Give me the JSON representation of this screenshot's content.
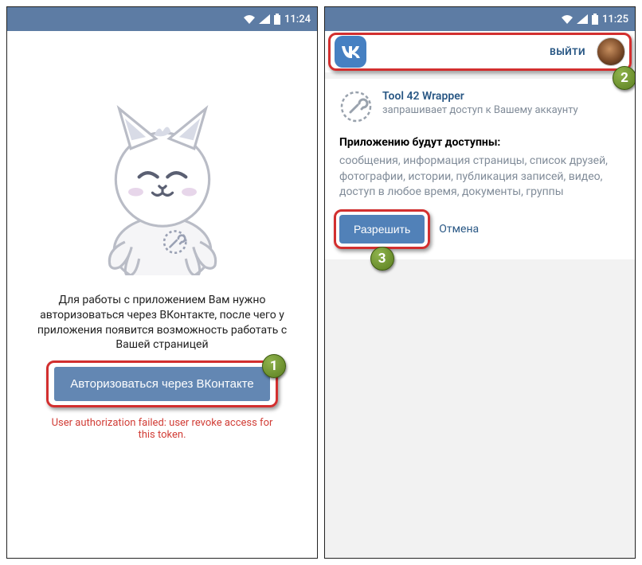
{
  "status": {
    "time1": "11:24",
    "time2": "11:25"
  },
  "screen1": {
    "description": "Для работы с приложением Вам нужно авторизоваться через ВКонтакте, после чего у приложения появится возможность работать с Вашей страницей",
    "auth_button": "Авторизоваться через ВКонтакте",
    "error": "User authorization failed: user revoke access for this token."
  },
  "screen2": {
    "logout": "ВЫЙТИ",
    "app_name": "Tool 42 Wrapper",
    "app_subtitle": "запрашивает доступ к Вашему аккаунту",
    "permissions_title": "Приложению будут доступны:",
    "permissions_list": "сообщения, информация страницы, список друзей, фотографии, истории, публикация записей, видео, доступ в любое время, документы, группы",
    "allow": "Разрешить",
    "cancel": "Отмена"
  },
  "badges": {
    "one": "1",
    "two": "2",
    "three": "3"
  }
}
